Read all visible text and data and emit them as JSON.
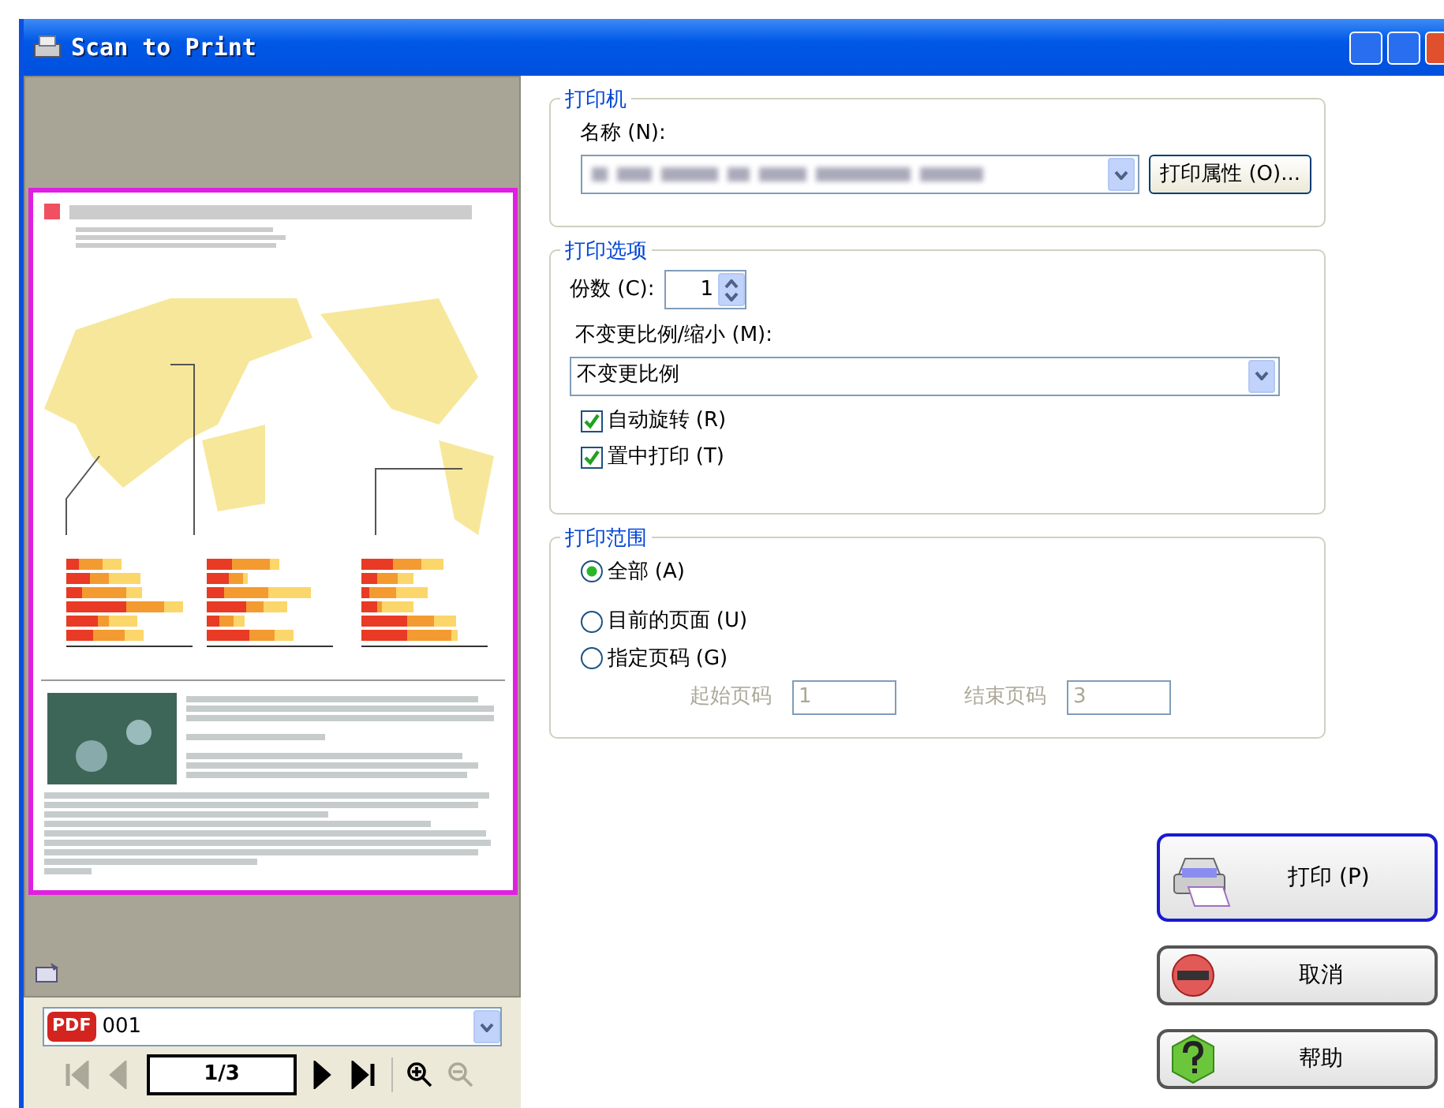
{
  "window": {
    "title": "Scan to Print"
  },
  "preview": {
    "file_badge": "PDF",
    "file_value": "001",
    "page_value": "1/3",
    "nav": [
      {
        "kind": "first",
        "disabled": true
      },
      {
        "kind": "prev",
        "disabled": true
      },
      {
        "kind": "page"
      },
      {
        "kind": "next",
        "disabled": false
      },
      {
        "kind": "last",
        "disabled": false
      },
      {
        "kind": "sep"
      },
      {
        "kind": "zoom_in",
        "disabled": false
      },
      {
        "kind": "zoom_out",
        "disabled": true
      }
    ]
  },
  "printer": {
    "legend": "打印机",
    "name_label": "名称 (N):",
    "properties_button": "打印属性 (O)..."
  },
  "options": {
    "legend": "打印选项",
    "copies_label": "份数 (C):",
    "copies_value": "1",
    "scale_label": "不变更比例/缩小 (M):",
    "scale_value": "不变更比例",
    "checkboxes": [
      {
        "label": "自动旋转 (R)",
        "checked": true
      },
      {
        "label": "置中打印 (T)",
        "checked": true
      }
    ]
  },
  "range": {
    "legend": "打印范围",
    "radios": [
      {
        "label": "全部 (A)",
        "selected": true
      },
      {
        "label": "目前的页面 (U)",
        "selected": false
      },
      {
        "label": "指定页码 (G)",
        "selected": false
      }
    ],
    "fields_disabled": true,
    "start_label": "起始页码",
    "start_value": "1",
    "end_label": "结束页码",
    "end_value": "3"
  },
  "buttons": [
    {
      "kind": "print",
      "label": "打印 (P)",
      "default": true
    },
    {
      "kind": "cancel",
      "label": "取消",
      "default": false
    },
    {
      "kind": "help",
      "label": "帮助",
      "default": false
    }
  ]
}
